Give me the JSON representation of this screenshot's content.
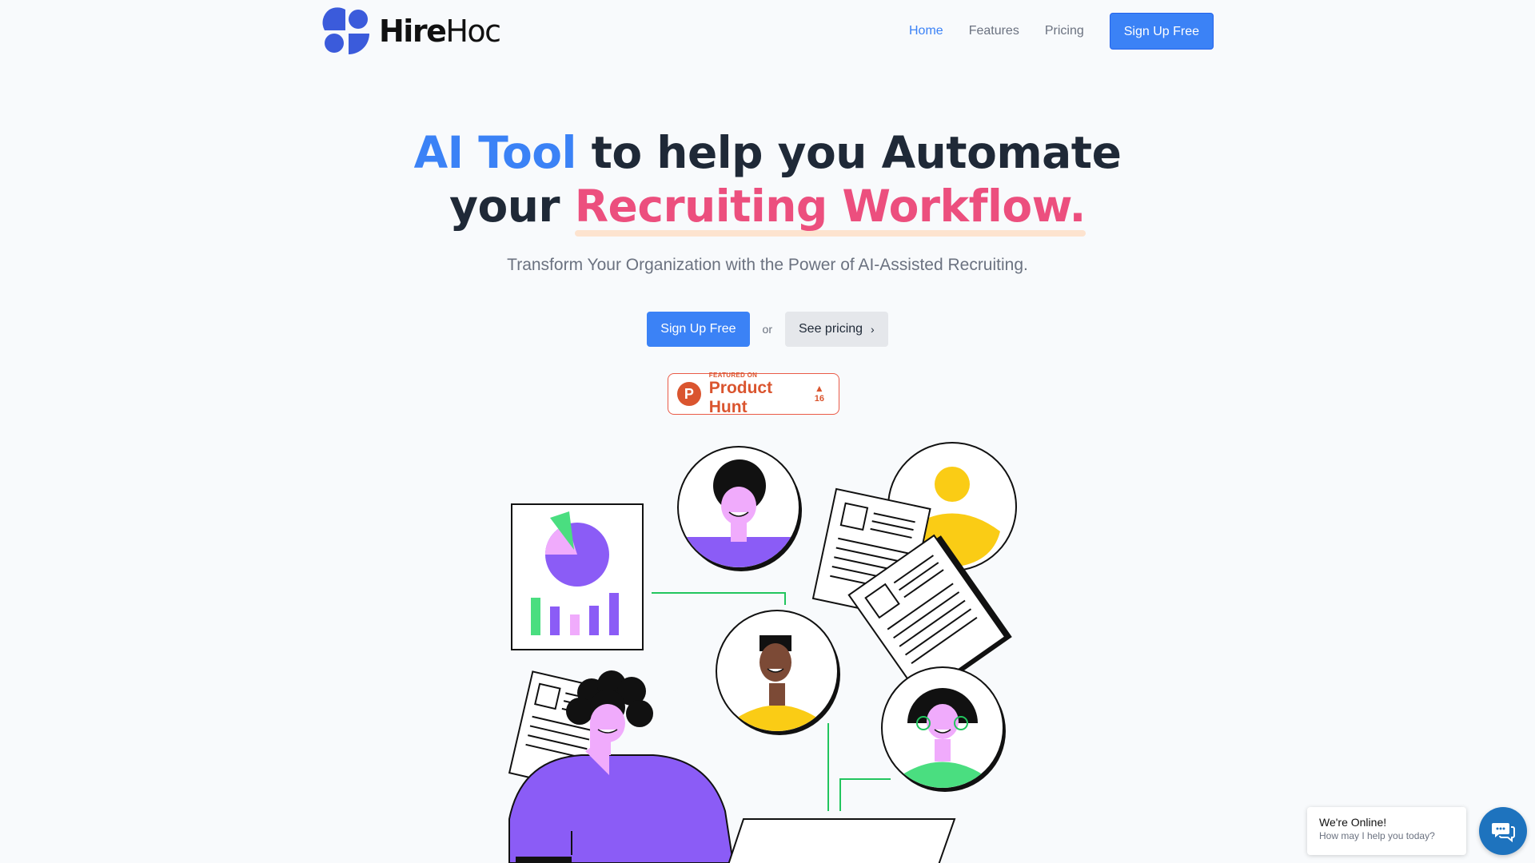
{
  "brand": {
    "name_bold": "Hire",
    "name_regular": "Hoc",
    "color": "#3b5bdb"
  },
  "nav": {
    "items": [
      {
        "label": "Home",
        "active": true
      },
      {
        "label": "Features",
        "active": false
      },
      {
        "label": "Pricing",
        "active": false
      }
    ],
    "cta": "Sign Up Free"
  },
  "hero": {
    "title_highlight_1": "AI Tool",
    "title_part_1": " to help you Automate",
    "title_part_2": "your ",
    "title_highlight_2": "Recruiting Workflow.",
    "subtitle": "Transform Your Organization with the Power of AI-Assisted Recruiting.",
    "primary_cta": "Sign Up Free",
    "separator": "or",
    "secondary_cta": "See pricing"
  },
  "product_hunt": {
    "featured_on": "FEATURED ON",
    "name": "Product Hunt",
    "votes": "16",
    "icon_letter": "P"
  },
  "chat": {
    "title": "We're Online!",
    "subtitle": "How may I help you today?"
  },
  "colors": {
    "accent": "#3b82f6",
    "pink": "#ec4f7e",
    "product_hunt": "#da552f",
    "chat": "#1e73be"
  }
}
